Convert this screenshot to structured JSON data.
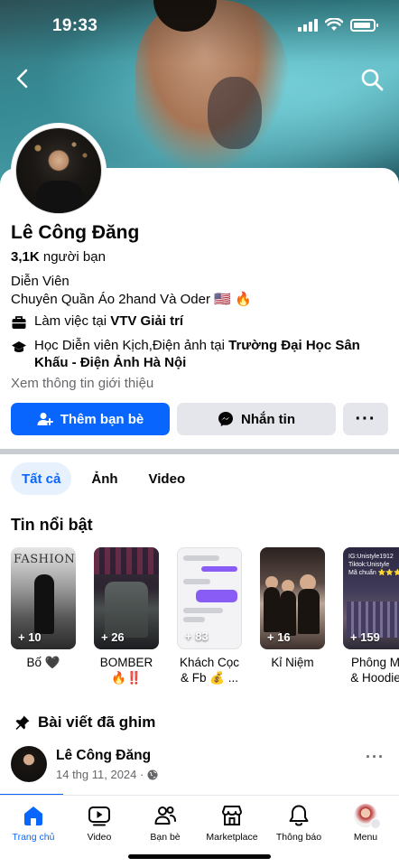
{
  "status_bar": {
    "time": "19:33"
  },
  "profile": {
    "name": "Lê Công Đăng",
    "friends_count": "3,1K",
    "friends_label": "người bạn",
    "bio_line1": "Diễn Viên",
    "bio_line2": "Chuyên Quần Áo 2hand Và Oder 🇺🇸 🔥",
    "work_prefix": "Làm việc tại",
    "work_place": "VTV Giải trí",
    "edu_prefix": "Học Diễn viên Kịch,Điện ảnh tại",
    "edu_place": "Trường Đại Học Sân Khấu - Điện Ảnh Hà Nội",
    "see_about": "Xem thông tin giới thiệu"
  },
  "actions": {
    "add_friend": "Thêm bạn bè",
    "message": "Nhắn tin",
    "more": "···"
  },
  "tabs": [
    {
      "label": "Tất cả",
      "active": true
    },
    {
      "label": "Ảnh",
      "active": false
    },
    {
      "label": "Video",
      "active": false
    }
  ],
  "highlights": {
    "title": "Tin nổi bật",
    "items": [
      {
        "count": "+ 10",
        "label": "Bố 🖤"
      },
      {
        "count": "+ 26",
        "label": "BOMBER",
        "label2": "🔥‼️"
      },
      {
        "count": "+ 83",
        "label": "Khách Cọc",
        "label2": "& Fb 💰 ..."
      },
      {
        "count": "+ 16",
        "label": "Kỉ Niệm"
      },
      {
        "count": "+ 159",
        "label": "Phông M",
        "label2": "& Hoodie"
      }
    ],
    "thumb_text_1": "FASHION",
    "thumb_text_5": "IG:Unistyle1912\nTiktok:Unistyle\nMã chuẩn ⭐⭐⭐"
  },
  "pinned": {
    "title": "Bài viết đã ghim",
    "post_author": "Lê Công Đăng",
    "post_date": "14 thg 11, 2024 ·",
    "more": "···"
  },
  "bottom_nav": [
    {
      "label": "Trang chủ",
      "active": true
    },
    {
      "label": "Video",
      "active": false
    },
    {
      "label": "Bạn bè",
      "active": false
    },
    {
      "label": "Marketplace",
      "active": false
    },
    {
      "label": "Thông báo",
      "active": false
    },
    {
      "label": "Menu",
      "active": false
    }
  ],
  "colors": {
    "primary": "#0866ff",
    "secondary_bg": "#e4e6eb",
    "muted_text": "#65676b"
  }
}
